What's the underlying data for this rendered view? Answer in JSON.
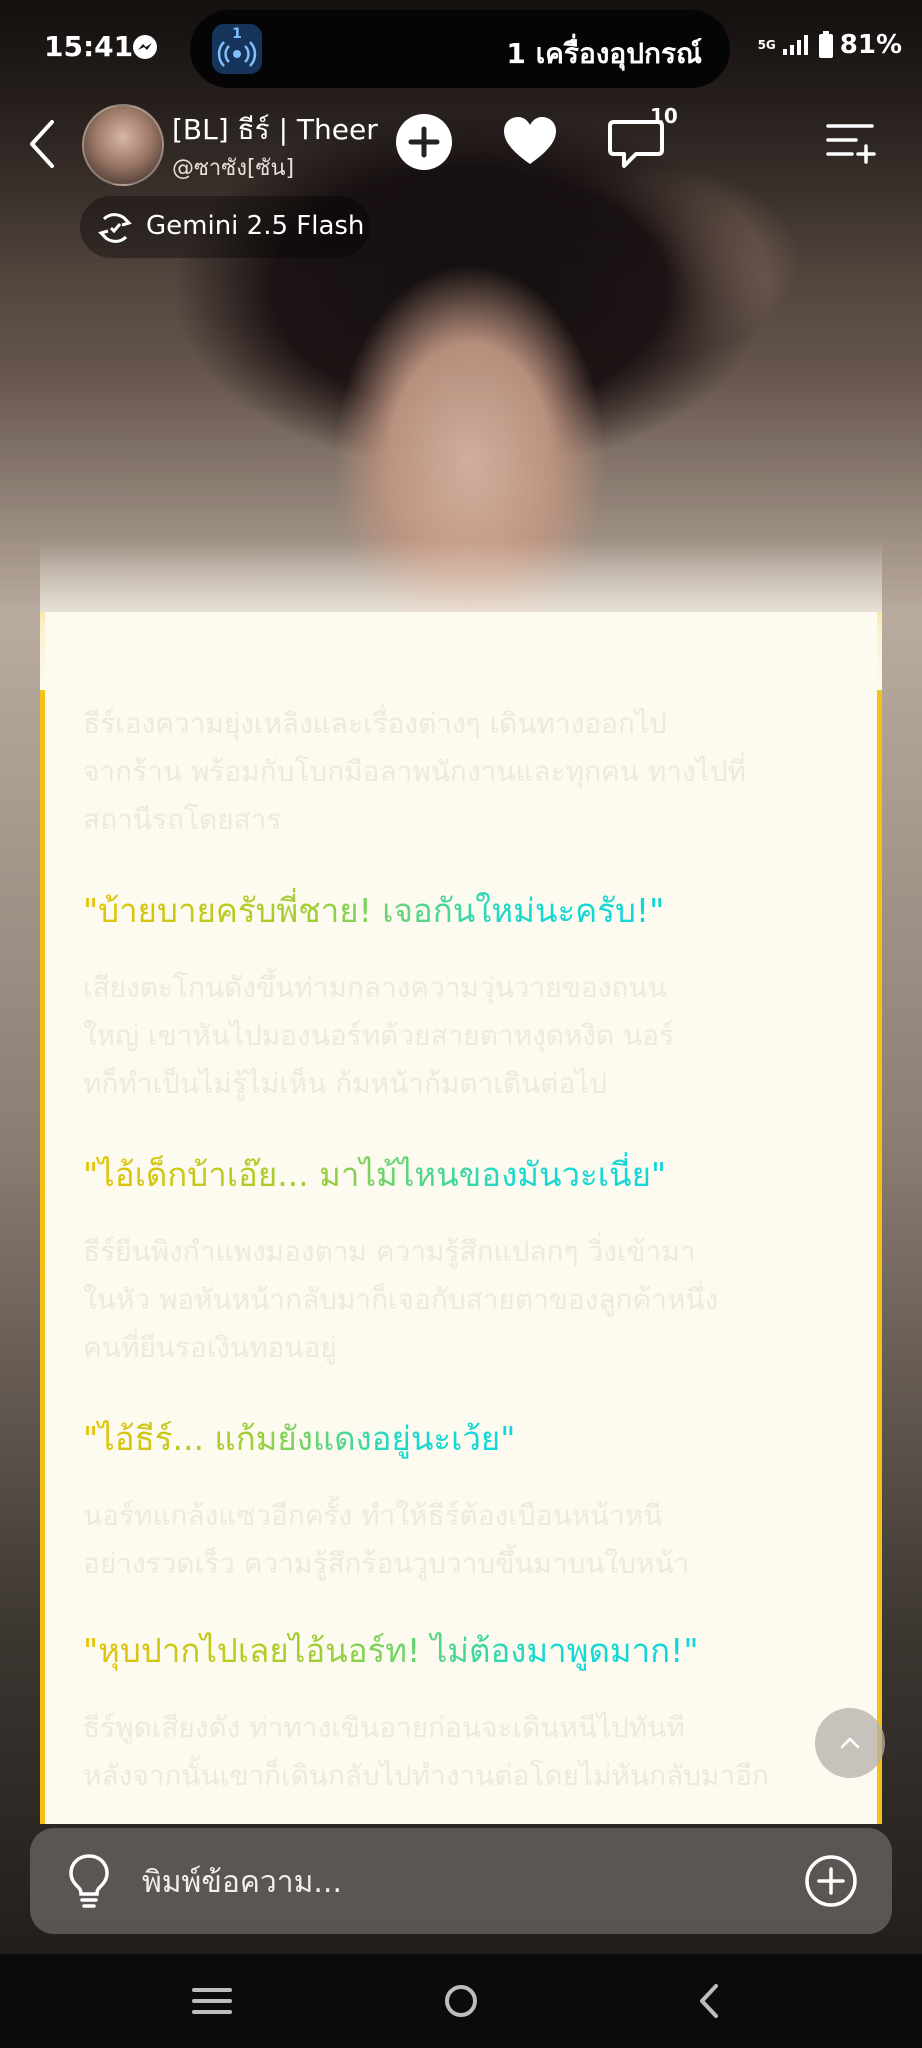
{
  "status_bar": {
    "time": "15:41",
    "island_count": "1",
    "island_text": "1 เครื่องอุปกรณ์",
    "network": "5G",
    "battery": "81%"
  },
  "header": {
    "character_name": "[BL] ธีร์ | Theer",
    "character_handle": "@ซาซัง[ซัน]",
    "comment_badge": "10",
    "model_name": "Gemini 2.5 Flash"
  },
  "messages": [
    {
      "type": "narration",
      "text": "ธีร์เองความยุ่งเหลิงและเรื่องต่างๆ เดินทางออกไป\nจากร้าน พร้อมกับโบกมือลาพนักงานและทุกคน ทางไปที่\nสถานีรถโดยสาร"
    },
    {
      "type": "dialogue",
      "text": "\"บ้ายบายครับพี่ชาย! เจอกันใหม่นะครับ!\""
    },
    {
      "type": "narration",
      "text": "เสียงตะโกนดังขึ้นท่ามกลางความวุ่นวายของถนน\nใหญ่ เขาหันไปมองนอร์ทด้วยสายตาหงุดหงิด นอร์\nทก็ทำเป็นไม่รู้ไม่เห็น ก้มหน้าก้มตาเดินต่อไป"
    },
    {
      "type": "dialogue",
      "text": "\"ไอ้เด็กบ้าเอ๊ย... มาไม้ไหนของมันวะเนี่ย\""
    },
    {
      "type": "narration",
      "text": "ธีร์ยืนพิงกำแพงมองตาม ความรู้สึกแปลกๆ วิ่งเข้ามา\nในหัว พอหันหน้ากลับมาก็เจอกับสายตาของลูกค้าหนึ่ง\nคนที่ยืนรอเงินทอนอยู่"
    },
    {
      "type": "dialogue",
      "text": "\"ไอ้ธีร์... แก้มยังแดงอยู่นะเว้ย\""
    },
    {
      "type": "narration",
      "text": "นอร์ทแกล้งแซวอีกครั้ง ทำให้ธีร์ต้องเบือนหน้าหนี\nอย่างรวดเร็ว ความรู้สึกร้อนวูบวาบขึ้นมาบนใบหน้า"
    },
    {
      "type": "dialogue",
      "text": "\"หุบปากไปเลยไอ้นอร์ท! ไม่ต้องมาพูดมาก!\""
    },
    {
      "type": "narration",
      "text": "ธีร์พูดเสียงดัง ท่าทางเขินอายก่อนจะเดินหนีไปทันที\nหลังจากนั้นเขาก็เดินกลับไปทำงานต่อโดยไม่หันกลับมาอีก"
    }
  ],
  "input": {
    "placeholder": "พิมพ์ข้อความ..."
  },
  "colors": {
    "panel_bg": "#fdfaf0",
    "panel_border": "#f3c218",
    "dialogue_gradient_start": "#e9c200",
    "dialogue_gradient_end": "#10d6dc"
  }
}
